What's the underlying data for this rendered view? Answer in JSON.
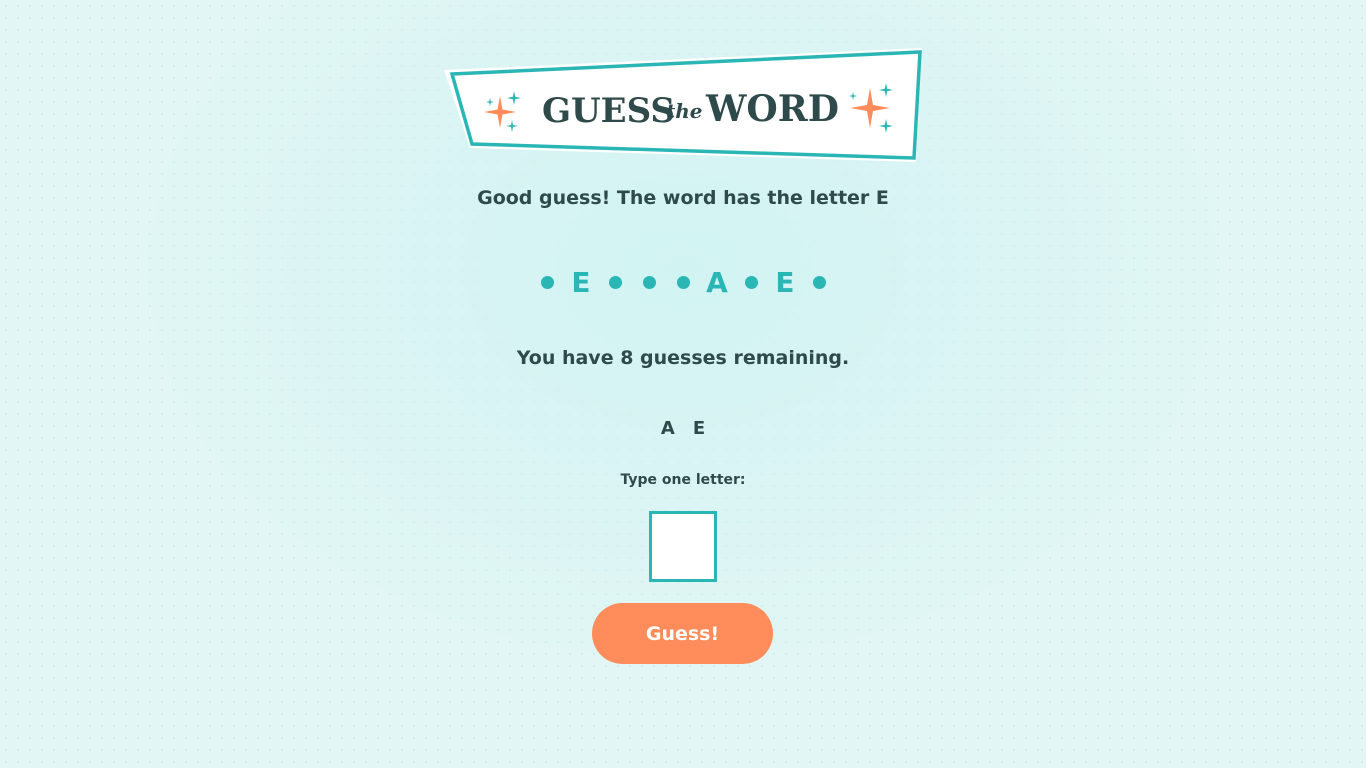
{
  "logo": {
    "word_guess": "GUESS",
    "word_the": "the",
    "word_word": "WORD"
  },
  "message": "Good guess! The word has the letter E",
  "word_progress": [
    {
      "type": "dot",
      "letter": ""
    },
    {
      "type": "letter",
      "letter": "E"
    },
    {
      "type": "dot",
      "letter": ""
    },
    {
      "type": "dot",
      "letter": ""
    },
    {
      "type": "dot",
      "letter": ""
    },
    {
      "type": "letter",
      "letter": "A"
    },
    {
      "type": "dot",
      "letter": ""
    },
    {
      "type": "letter",
      "letter": "E"
    },
    {
      "type": "dot",
      "letter": ""
    }
  ],
  "remaining_text": "You have 8 guesses remaining.",
  "guessed_letters": [
    "A",
    "E"
  ],
  "input": {
    "label": "Type one letter:",
    "value": ""
  },
  "guess_button_label": "Guess!",
  "colors": {
    "accent": "#2bb6b6",
    "button": "#ff8c5a",
    "text": "#2f4a4a",
    "background": "#e2f6f5"
  }
}
